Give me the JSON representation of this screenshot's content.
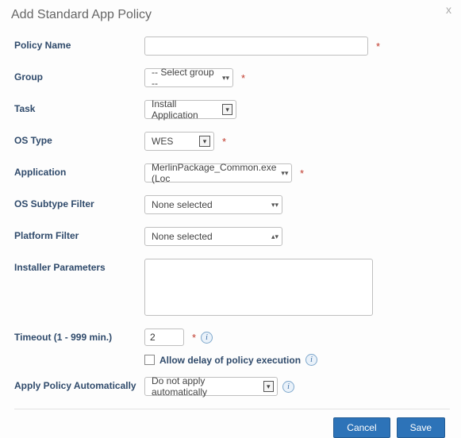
{
  "dialog": {
    "title": "Add Standard App Policy"
  },
  "labels": {
    "policy_name": "Policy Name",
    "group": "Group",
    "task": "Task",
    "os_type": "OS Type",
    "application": "Application",
    "os_subtype_filter": "OS Subtype Filter",
    "platform_filter": "Platform Filter",
    "installer_parameters": "Installer Parameters",
    "timeout": "Timeout (1 - 999 min.)",
    "allow_delay": "Allow delay of policy execution",
    "apply_auto": "Apply Policy Automatically"
  },
  "values": {
    "policy_name": "",
    "group": "-- Select group --",
    "task": "Install Application",
    "os_type": "WES",
    "application": "MerlinPackage_Common.exe (Loc",
    "os_subtype_filter": "None selected",
    "platform_filter": "None selected",
    "installer_parameters": "",
    "timeout": "2",
    "apply_auto": "Do not apply automatically"
  },
  "buttons": {
    "cancel": "Cancel",
    "save": "Save"
  },
  "marks": {
    "required": "*"
  }
}
